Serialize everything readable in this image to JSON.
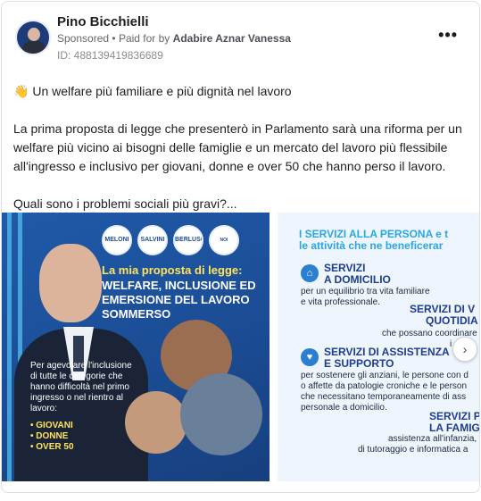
{
  "post": {
    "author": "Pino Bicchielli",
    "sponsored": "Sponsored",
    "paid_for_by_label": "Paid for by",
    "paid_for_by": "Adabire Aznar Vanessa",
    "ad_id": "ID: 488139419836689",
    "more_icon": "more-horizontal-icon"
  },
  "body": {
    "headline_icon": "waving-hand",
    "headline": "Un welfare più familiare e più dignità nel lavoro",
    "paragraph": "La prima proposta di legge che presenterò in Parlamento sarà una riforma per un welfare più vicino ai bisogni delle famiglie e un mercato del lavoro più flessibile all'ingresso e inclusivo per giovani, donne e over 50 che hanno perso il lavoro.",
    "question": "Quali sono i problemi sociali più gravi?..."
  },
  "slide1": {
    "logos": [
      "MELONI",
      "SALVINI",
      "BERLUSCONI",
      "NOI MODERATI"
    ],
    "title_line1": "La mia proposta di legge:",
    "title_line2": "WELFARE, INCLUSIONE ED EMERSIONE DEL LAVORO SOMMERSO",
    "description": "Per agevolare l'inclusione di tutte le categorie che hanno difficoltà nel primo ingresso o nel rientro al lavoro:",
    "list": [
      "• GIOVANI",
      "• DONNE",
      "• OVER 50"
    ]
  },
  "slide2": {
    "heading_line1": "I SERVIZI ALLA PERSONA e t",
    "heading_line2": "le attività che ne beneficerar",
    "block1_title_line1": "SERVIZI",
    "block1_title_line2": "A DOMICILIO",
    "block1_text_line1": "per un equilibrio tra vita familiare",
    "block1_text_line2": "e vita professionale.",
    "block2_title_line1": "SERVIZI DI V",
    "block2_title_line2": "QUOTIDIA",
    "block2_text_line1": "che possano coordinare e",
    "block2_text_line2": "i ser",
    "block3_title_line1": "SERVIZI DI ASSISTENZA",
    "block3_title_line2": "E SUPPORTO",
    "block3_text_line1": "per sostenere gli anziani, le persone con d",
    "block3_text_line2": "o affette da patologie croniche e le person",
    "block3_text_line3": "che necessitano temporaneamente di ass",
    "block3_text_line4": "personale a domicilio.",
    "block4_title_line1": "SERVIZI P",
    "block4_title_line2": "LA FAMIG",
    "block4_text_line1": "assistenza all'infanzia, amm",
    "block4_text_line2": "di tutoraggio e informatica a"
  },
  "carousel": {
    "next_icon": "chevron-right-icon"
  }
}
